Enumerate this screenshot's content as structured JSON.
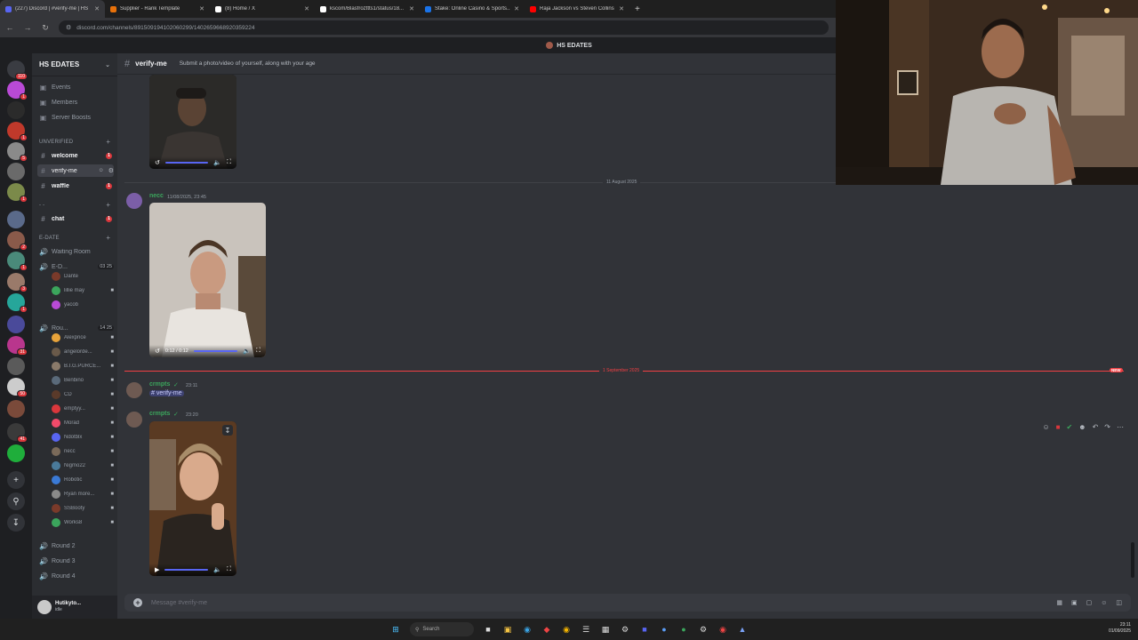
{
  "browser": {
    "tabs": [
      {
        "title": "(227) Discord | #verify-me | HS",
        "color": "#5865f2",
        "active": true
      },
      {
        "title": "Supplier - Rank Template",
        "color": "#e8710a"
      },
      {
        "title": "(8) Home / X",
        "color": "#ffffff"
      },
      {
        "title": "kscom/Blasfrozttts1/status/18...",
        "color": "#ffffff"
      },
      {
        "title": "Stake: Online Casino & Sports...",
        "color": "#1a73e8"
      },
      {
        "title": "Raja Jackson vs Steven Collins",
        "color": "#ff0000"
      }
    ],
    "new_tab": "+",
    "url": "discord.com/channels/891509194102060299/1402659668920359224"
  },
  "discord": {
    "title_strip": "HS EDATES",
    "server_name": "HS EDATES",
    "server_links": [
      {
        "label": "Events",
        "icon": "calendar-icon"
      },
      {
        "label": "Members",
        "icon": "members-icon"
      },
      {
        "label": "Server Boosts",
        "icon": "boost-icon"
      }
    ],
    "categories": {
      "unverified": "UNVERIFIED",
      "dashes": "- -",
      "edate": "E-Date"
    },
    "channels": {
      "welcome": "welcome",
      "verify_me": "verify-me",
      "waffle": "waffle",
      "chat": "chat",
      "waiting_room": "Waiting Room",
      "edate_vc": "E-D...",
      "edate_vc_count": "03 25",
      "rounds_vc": "Rou...",
      "rounds_vc_count": "14 25",
      "round2": "Round 2",
      "round3": "Round 3",
      "round4": "Round 4"
    },
    "voice_users_a": [
      "Dante",
      "lillie may",
      "yacob"
    ],
    "voice_users_b": [
      "Alexprice",
      "angelorde...",
      "B.I.G.PURCE...",
      "Benbino",
      "CD",
      "emptyy...",
      "Morad",
      "Ndotblx",
      "necc",
      "Nigmo22",
      "Robotic",
      "Ryan more...",
      "SSBooty",
      "Works8"
    ],
    "mention_count": "1",
    "guild_badges": [
      "110",
      "1",
      "1",
      "5",
      "1",
      "2",
      "1",
      "3",
      "1",
      "31",
      "50",
      "41"
    ],
    "user_panel": {
      "name": "Hutikyto...",
      "status": "idle"
    },
    "channel_header": {
      "name": "verify-me",
      "topic": "Submit a photo/video of yourself, along with your age"
    },
    "messages": {
      "date1": "11 August 2025",
      "necc_name": "necc",
      "necc_time": "11/08/2025, 23:45",
      "video2_time": "0:12 / 0:12",
      "date2": "1 September 2025",
      "new_label": "NEW",
      "crmpts_name": "crmpts",
      "crmpts_time1": "23:11",
      "crmpts_channel_mention": "# verify-me",
      "crmpts_time2": "23:20"
    },
    "composer_placeholder": "Message #verify-me"
  },
  "taskbar": {
    "search_label": "Search",
    "time": "23:11",
    "date": "01/09/2025"
  }
}
